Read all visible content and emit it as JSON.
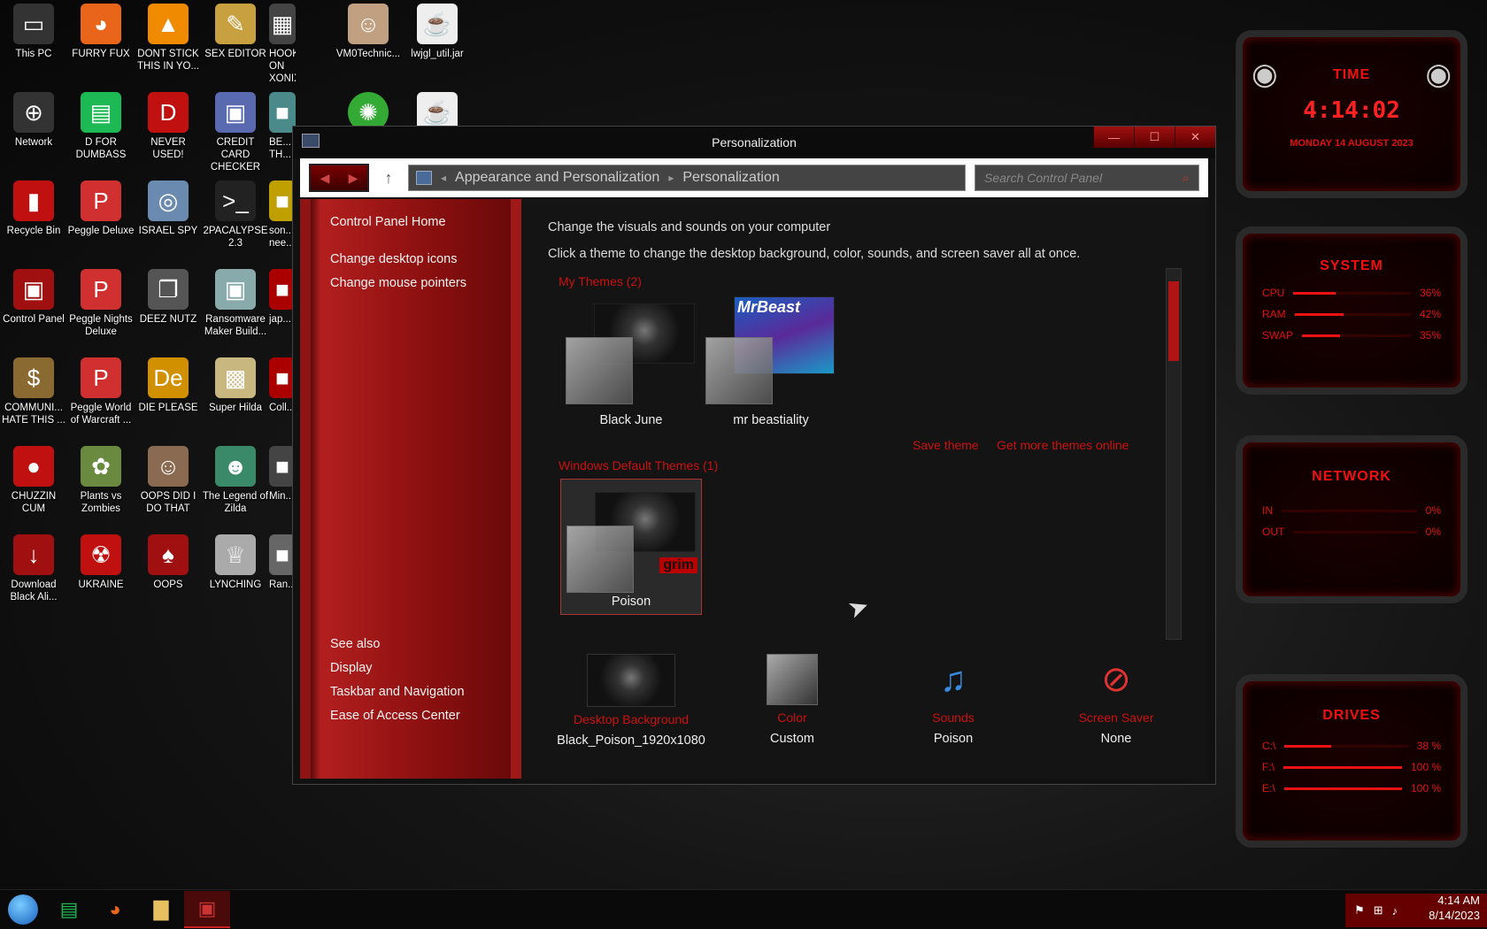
{
  "desktop_icons": [
    {
      "label": "This PC",
      "icon": "monitor-icon",
      "color": "#333"
    },
    {
      "label": "FURRY FUX",
      "icon": "firefox-icon",
      "color": "#e8651a"
    },
    {
      "label": "DONT STICK THIS IN YO...",
      "icon": "vlc-icon",
      "color": "#f08a00"
    },
    {
      "label": "SEX EDITOR",
      "icon": "editor-icon",
      "color": "#c8a040"
    },
    {
      "label": "HOOKED ON XONIX",
      "icon": "game-icon",
      "color": "#444"
    },
    {
      "label": "Network",
      "icon": "network-icon",
      "color": "#333"
    },
    {
      "label": "D FOR DUMBASS",
      "icon": "chat-icon",
      "color": "#1db954"
    },
    {
      "label": "NEVER USED!",
      "icon": "devcpp-icon",
      "color": "#c01010"
    },
    {
      "label": "CREDIT CARD CHECKER",
      "icon": "window-icon",
      "color": "#5a6ab0"
    },
    {
      "label": "BE... TH...",
      "icon": "app-icon",
      "color": "#4a8a8a"
    },
    {
      "label": "Recycle Bin",
      "icon": "recycle-bin-icon",
      "color": "#c01010"
    },
    {
      "label": "Peggle Deluxe",
      "icon": "peggle-icon",
      "color": "#d03030"
    },
    {
      "label": "ISRAEL SPY",
      "icon": "spy-icon",
      "color": "#6a8ab0"
    },
    {
      "label": "2PACALYPSE 2.3",
      "icon": "terminal-icon",
      "color": "#222"
    },
    {
      "label": "son... nee...",
      "icon": "app-icon",
      "color": "#c0a000"
    },
    {
      "label": "Control Panel",
      "icon": "control-panel-icon",
      "color": "#a01010"
    },
    {
      "label": "Peggle Nights Deluxe",
      "icon": "peggle-icon",
      "color": "#d03030"
    },
    {
      "label": "DEEZ NUTZ",
      "icon": "stack-icon",
      "color": "#555"
    },
    {
      "label": "Ransomware Maker Build...",
      "icon": "window-icon",
      "color": "#8aa"
    },
    {
      "label": "jap...",
      "icon": "app-icon",
      "color": "#a00"
    },
    {
      "label": "COMMUNI... HATE THIS ...",
      "icon": "money-bag-icon",
      "color": "#8a6a30"
    },
    {
      "label": "Peggle World of Warcraft ...",
      "icon": "peggle-icon",
      "color": "#d03030"
    },
    {
      "label": "DIE PLEASE",
      "icon": "de-icon",
      "color": "#d09000"
    },
    {
      "label": "Super Hilda",
      "icon": "pixel-icon",
      "color": "#c8b880"
    },
    {
      "label": "Coll...",
      "icon": "app-icon",
      "color": "#a00"
    },
    {
      "label": "CHUZZIN CUM",
      "icon": "chuzzle-icon",
      "color": "#c01010"
    },
    {
      "label": "Plants vs Zombies",
      "icon": "flower-icon",
      "color": "#6a8a40"
    },
    {
      "label": "OOPS DID I DO THAT",
      "icon": "portrait-icon",
      "color": "#8a6a50"
    },
    {
      "label": "The Legend of Zilda",
      "icon": "pixel-hero-icon",
      "color": "#3a8a6a"
    },
    {
      "label": "Min...",
      "icon": "app-icon",
      "color": "#444"
    },
    {
      "label": "Download Black Ali...",
      "icon": "download-icon",
      "color": "#a01010"
    },
    {
      "label": "UKRAINE",
      "icon": "radiation-icon",
      "color": "#c01010"
    },
    {
      "label": "OOPS",
      "icon": "card-icon",
      "color": "#a01010"
    },
    {
      "label": "LYNCHING",
      "icon": "lynching-icon",
      "color": "#aaa"
    },
    {
      "label": "Ran...",
      "icon": "app-icon",
      "color": "#666"
    }
  ],
  "extra_icons": [
    {
      "label": "VM0Technic...",
      "icon": "person-icon"
    },
    {
      "label": "lwjgl_util.jar",
      "icon": "java-icon"
    }
  ],
  "window": {
    "title": "Personalization",
    "controls": [
      "—",
      "☐",
      "✕"
    ],
    "breadcrumb": [
      "Appearance and Personalization",
      "Personalization"
    ],
    "search_placeholder": "Search Control Panel",
    "sidebar": {
      "home": "Control Panel Home",
      "links": [
        "Change desktop icons",
        "Change mouse pointers"
      ],
      "see_also": "See also",
      "see_also_links": [
        "Display",
        "Taskbar and Navigation",
        "Ease of Access Center"
      ]
    },
    "main": {
      "heading": "Change the visuals and sounds on your computer",
      "subheading": "Click a theme to change the desktop background, color, sounds, and screen saver all at once.",
      "my_themes_label": "My Themes (2)",
      "my_themes": [
        "Black June",
        "mr beastiality"
      ],
      "save_theme": "Save theme",
      "get_more": "Get more themes online",
      "default_themes_label": "Windows Default Themes (1)",
      "default_themes": [
        "Poison"
      ],
      "grim_text": "grim",
      "mrbeast_text": "MrBeast",
      "bottom": [
        {
          "caption": "Desktop Background",
          "value": "Black_Poison_1920x1080"
        },
        {
          "caption": "Color",
          "value": "Custom"
        },
        {
          "caption": "Sounds",
          "value": "Poison"
        },
        {
          "caption": "Screen Saver",
          "value": "None"
        }
      ]
    }
  },
  "gadgets": {
    "time": {
      "title": "TIME",
      "clock": "4:14:02",
      "date": "MONDAY 14 AUGUST 2023"
    },
    "system": {
      "title": "SYSTEM",
      "rows": [
        {
          "label": "CPU",
          "value": "36%",
          "level": 0.36
        },
        {
          "label": "RAM",
          "value": "42%",
          "level": 0.42
        },
        {
          "label": "SWAP",
          "value": "35%",
          "level": 0.35
        }
      ]
    },
    "network": {
      "title": "NETWORK",
      "rows": [
        {
          "label": "IN",
          "value": "0%",
          "level": 0.0
        },
        {
          "label": "OUT",
          "value": "0%",
          "level": 0.0
        }
      ]
    },
    "drives": {
      "title": "DRIVES",
      "rows": [
        {
          "label": "C:\\",
          "value": "38 %",
          "level": 0.38
        },
        {
          "label": "F:\\",
          "value": "100 %",
          "level": 1.0
        },
        {
          "label": "E:\\",
          "value": "100 %",
          "level": 1.0
        }
      ]
    }
  },
  "taskbar": {
    "apps": [
      "start-orb-icon",
      "chat-icon",
      "firefox-icon",
      "file-explorer-icon",
      "control-panel-icon"
    ],
    "time": "4:14 AM",
    "date": "8/14/2023"
  },
  "colors": {
    "accent": "#b01515",
    "link": "#cc1111",
    "text": "#eeeeee"
  }
}
